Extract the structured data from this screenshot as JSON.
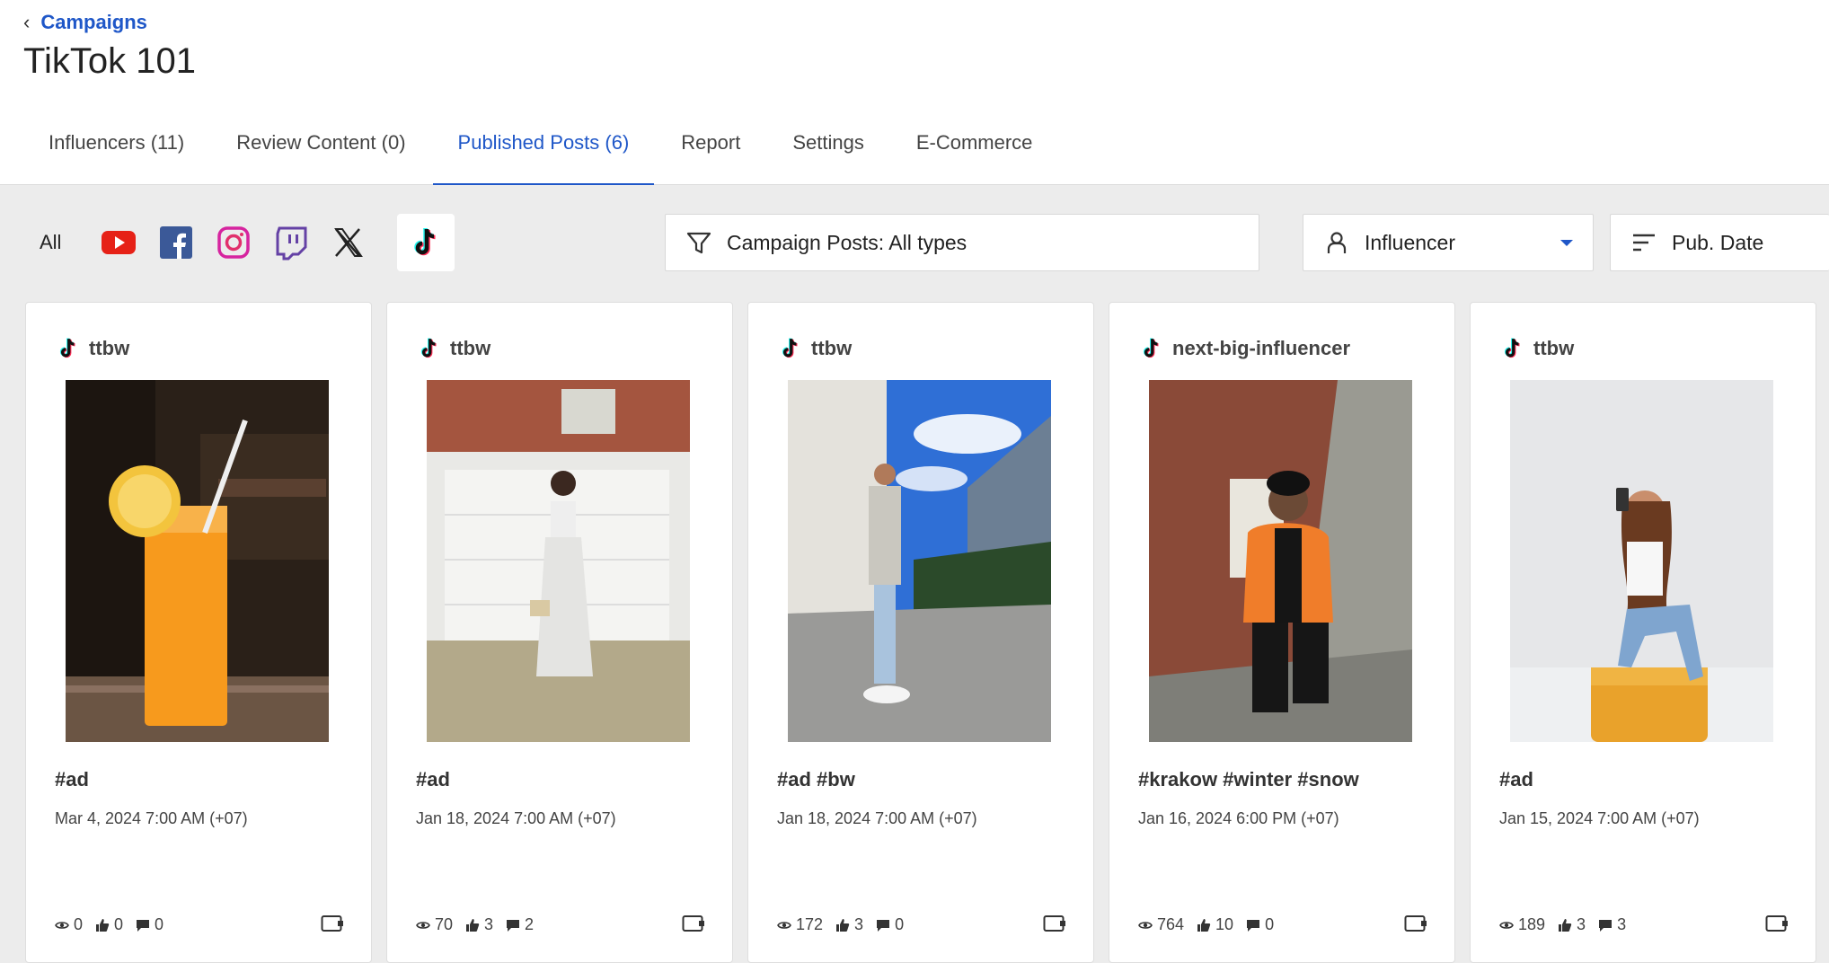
{
  "breadcrumb": {
    "back_label": "Campaigns"
  },
  "page": {
    "title": "TikTok 101"
  },
  "tabs": [
    {
      "label": "Influencers (11)"
    },
    {
      "label": "Review Content (0)"
    },
    {
      "label": "Published Posts (6)"
    },
    {
      "label": "Report"
    },
    {
      "label": "Settings"
    },
    {
      "label": "E-Commerce"
    }
  ],
  "active_tab": "Published Posts (6)",
  "platforms": {
    "all_label": "All",
    "icons": [
      "youtube-icon",
      "facebook-icon",
      "instagram-icon",
      "twitch-icon",
      "x-icon",
      "tiktok-icon"
    ],
    "selected": "tiktok-icon"
  },
  "filters": {
    "post_type": "Campaign Posts: All types",
    "influencer": "Influencer",
    "sort": "Pub. Date"
  },
  "colors": {
    "accent": "#1f57c8",
    "background": "#ececec"
  },
  "posts": [
    {
      "author": "ttbw",
      "caption": "#ad",
      "date": "Mar 4, 2024 7:00 AM (+07)",
      "views": "0",
      "likes": "0",
      "comments": "0"
    },
    {
      "author": "ttbw",
      "caption": "#ad",
      "date": "Jan 18, 2024 7:00 AM (+07)",
      "views": "70",
      "likes": "3",
      "comments": "2"
    },
    {
      "author": "ttbw",
      "caption": "#ad #bw",
      "date": "Jan 18, 2024 7:00 AM (+07)",
      "views": "172",
      "likes": "3",
      "comments": "0"
    },
    {
      "author": "next-big-influencer",
      "caption": "#krakow #winter #snow",
      "date": "Jan 16, 2024 6:00 PM (+07)",
      "views": "764",
      "likes": "10",
      "comments": "0"
    },
    {
      "author": "ttbw",
      "caption": "#ad",
      "date": "Jan 15, 2024 7:00 AM (+07)",
      "views": "189",
      "likes": "3",
      "comments": "3"
    }
  ]
}
